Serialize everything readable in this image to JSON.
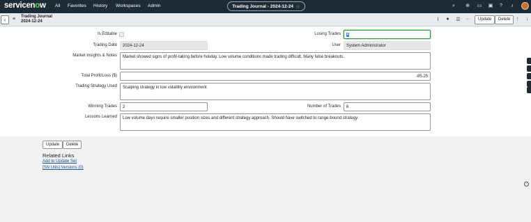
{
  "app": {
    "logo_part1": "servicen",
    "logo_o": "o",
    "logo_part2": "w",
    "nav": [
      "All",
      "Favorites",
      "History",
      "Workspaces",
      "Admin"
    ],
    "title": "Trading Journal - 2024-12-24",
    "icons": [
      "search-icon",
      "globe-icon",
      "chat-icon",
      "inbox-icon",
      "help-icon",
      "bell-icon",
      "avatar"
    ]
  },
  "header": {
    "title_line1": "Trading Journal",
    "title_line2": "2024-12-24",
    "update_label": "Update",
    "delete_label": "Delete",
    "icons": [
      "attachment-icon",
      "activity-icon",
      "settings-icon",
      "more-icon",
      "up-icon",
      "down-icon"
    ]
  },
  "form": {
    "is_editable_label": "Is Editable",
    "is_editable_value": false,
    "losing_trades_label": "Losing Trades",
    "losing_trades_value": "4",
    "trading_date_label": "Trading Date",
    "trading_date_value": "2024-12-24",
    "user_label": "User",
    "user_value": "System Administrator",
    "market_insights_label": "Market Insights & Notes",
    "market_insights_value": "Market showed signs of profit-taking before holiday. Low volume conditions made trading difficult. Many false breakouts.",
    "total_pl_label": "Total Profit/Loss ($)",
    "total_pl_value": "-85.25",
    "strategy_label": "Trading Strategy Used",
    "strategy_value": "Scalping strategy in low volatility environment",
    "winning_trades_label": "Winning Trades",
    "winning_trades_value": "2",
    "number_trades_label": "Number of Trades",
    "number_trades_value": "6",
    "lessons_label": "Lessons Learned",
    "lessons_value": "Low volume days require smaller position sizes and different strategy approach. Should have switched to range-bound strategy."
  },
  "footer": {
    "update_label": "Update",
    "delete_label": "Delete",
    "related_links_title": "Related Links",
    "links": [
      "Add to Update Set",
      "[SN Utils] Versions (0)"
    ]
  }
}
